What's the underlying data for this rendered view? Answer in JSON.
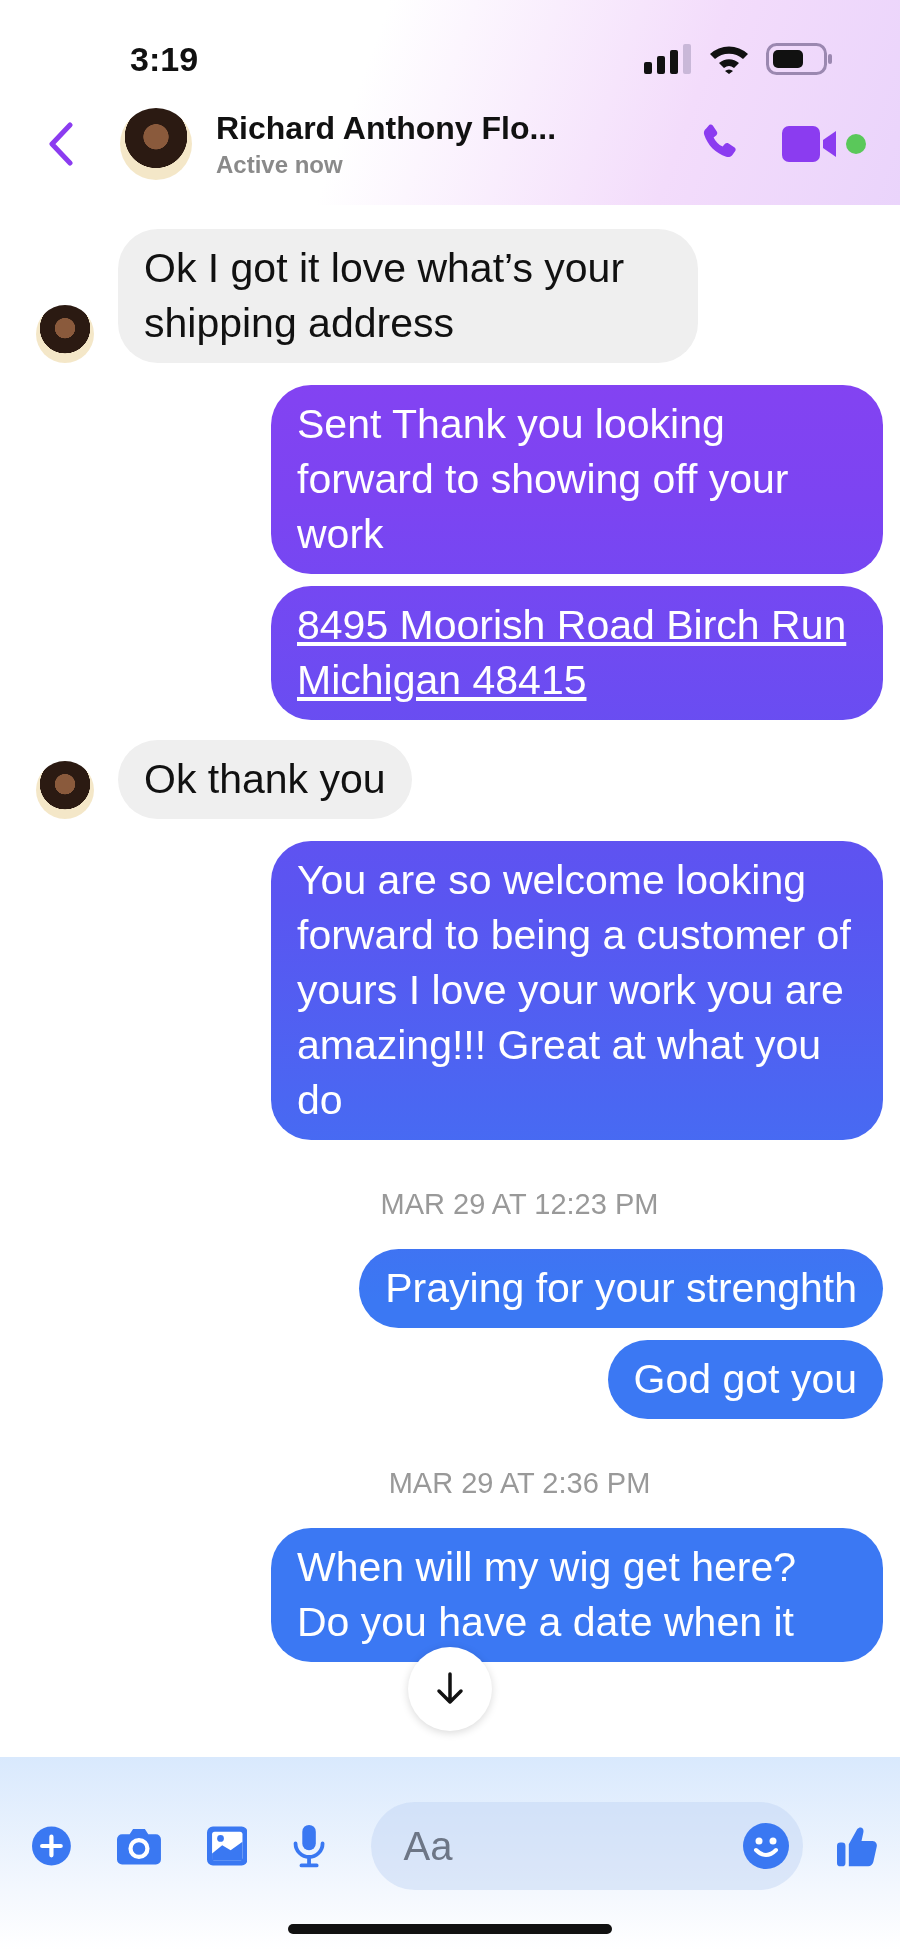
{
  "status_bar": {
    "time": "3:19"
  },
  "header": {
    "name": "Richard Anthony Flo...",
    "status": "Active now",
    "online": true
  },
  "messages": [
    {
      "kind": "received",
      "text": "Ok I got it love what’s your shipping address",
      "avatar": true
    },
    {
      "kind": "sent",
      "text": "Sent Thank you looking forward to showing off your work",
      "link": false
    },
    {
      "kind": "sent",
      "text": "8495 Moorish Road Birch Run Michigan 48415",
      "link": true
    },
    {
      "kind": "received",
      "text": "Ok thank you",
      "avatar": true
    },
    {
      "kind": "sent",
      "text": "You are so welcome looking forward to being a customer of yours I love your work you are amazing!!! Great at what you do",
      "link": false
    },
    {
      "kind": "timestamp",
      "text": "MAR 29 AT 12:23 PM"
    },
    {
      "kind": "sent",
      "text": "Praying for your strenghth",
      "link": false
    },
    {
      "kind": "sent",
      "text": "God got you",
      "link": false
    },
    {
      "kind": "timestamp",
      "text": "MAR 29 AT 2:36 PM"
    },
    {
      "kind": "sent",
      "text": "When will my wig get here? Do you have a date when it",
      "link": false
    }
  ],
  "composer": {
    "placeholder": "Aa"
  }
}
